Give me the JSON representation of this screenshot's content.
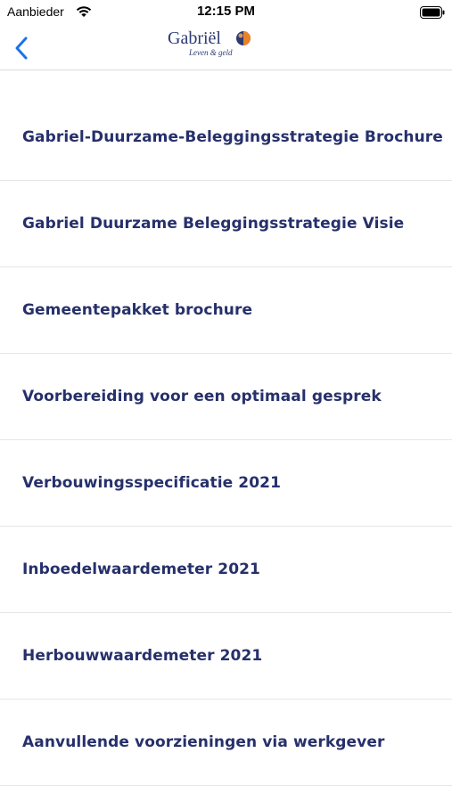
{
  "status_bar": {
    "carrier": "Aanbieder",
    "time": "12:15 PM"
  },
  "nav": {
    "back_icon": "chevron-left-icon",
    "logo_name": "Gabriël",
    "logo_tagline": "Leven & geld",
    "accent_color": "#1a73e8"
  },
  "documents": [
    {
      "label": "Gabriel-Duurzame-Beleggingsstrategie Brochure"
    },
    {
      "label": "Gabriel Duurzame Beleggingsstrategie Visie"
    },
    {
      "label": "Gemeentepakket brochure"
    },
    {
      "label": "Voorbereiding voor een optimaal gesprek"
    },
    {
      "label": "Verbouwingsspecificatie 2021"
    },
    {
      "label": "Inboedelwaardemeter 2021"
    },
    {
      "label": "Herbouwwaardemeter 2021"
    },
    {
      "label": "Aanvullende voorzieningen via werkgever"
    }
  ]
}
